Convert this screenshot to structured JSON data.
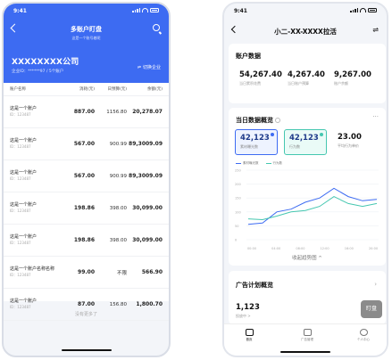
{
  "left": {
    "status": {
      "time": "9:41"
    },
    "nav": {
      "title": "多账户盯盘",
      "subtitle": "这是一个账号着呢"
    },
    "company": {
      "name": "XXXXXXXX公司",
      "id_line": "企业ID：******97 / 5个账户",
      "switch_label": "切换企业"
    },
    "table": {
      "headers": [
        "账户名称",
        "消耗(元)",
        "日预算(元)",
        "余额(元)"
      ],
      "rows": [
        {
          "name": "这是一个账户",
          "id": "ID：123487",
          "cost": "887.00",
          "budget": "1156.80",
          "balance": "20,278.07"
        },
        {
          "name": "这是一个账户",
          "id": "ID：123487",
          "cost": "567.00",
          "budget": "900.99",
          "balance": "89,3009.09"
        },
        {
          "name": "这是一个账户",
          "id": "ID：123487",
          "cost": "567.00",
          "budget": "900.99",
          "balance": "89,3009.09"
        },
        {
          "name": "这是一个账户",
          "id": "ID：123487",
          "cost": "198.86",
          "budget": "398.00",
          "balance": "30,099.00"
        },
        {
          "name": "这是一个账户",
          "id": "ID：123487",
          "cost": "198.86",
          "budget": "398.00",
          "balance": "30,099.00"
        },
        {
          "name": "这是一个账户名称名称",
          "id": "ID：123487",
          "cost": "99.00",
          "budget": "不限",
          "balance": "566.90"
        },
        {
          "name": "这是一个账户",
          "id": "ID：123487",
          "cost": "87.00",
          "budget": "156.80",
          "balance": "1,800.70"
        }
      ]
    },
    "no_more": "没有更多了"
  },
  "right": {
    "status": {
      "time": "9:41"
    },
    "nav": {
      "title": "小二-XX-XXXX拉活"
    },
    "account": {
      "title": "账户数据",
      "kpis": [
        {
          "value": "54,267.40",
          "label": "当日累积花费"
        },
        {
          "value": "4,267.40",
          "label": "当日账户预算"
        },
        {
          "value": "9,267.00",
          "label": "账户余额"
        }
      ]
    },
    "overview": {
      "title": "当日数据概览",
      "boxes": [
        {
          "value": "42,123",
          "label": "素材曝光数"
        },
        {
          "value": "42,123",
          "label": "行为数"
        },
        {
          "value": "23.00",
          "label": "平均行为单价"
        }
      ],
      "legend": [
        "素材曝光数",
        "行为数"
      ],
      "collapse_label": "收起趋势图 ^"
    },
    "ad": {
      "title": "广告计划概览",
      "value": "1,123",
      "label": "投放中 >"
    },
    "fab_label": "盯盘",
    "tabs": [
      {
        "label": "首页"
      },
      {
        "label": "广告管理"
      },
      {
        "label": "个人中心"
      }
    ]
  },
  "chart_data": {
    "type": "line",
    "x": [
      "00:00",
      "04:00",
      "08:00",
      "12:00",
      "16:00",
      "20:00"
    ],
    "ylim": [
      0,
      250
    ],
    "y_ticks": [
      "250",
      "200",
      "150",
      "100",
      "50",
      "0"
    ],
    "series": [
      {
        "name": "素材曝光数",
        "color": "#3d6bf2",
        "values": [
          55,
          60,
          100,
          110,
          135,
          150,
          185,
          155,
          140,
          145
        ]
      },
      {
        "name": "行为数",
        "color": "#45c7b0",
        "values": [
          75,
          72,
          85,
          100,
          105,
          120,
          155,
          130,
          120,
          130
        ]
      }
    ]
  }
}
